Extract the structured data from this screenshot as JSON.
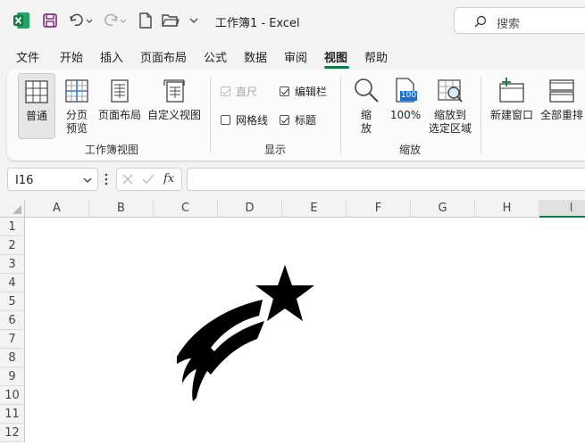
{
  "titlebar": {
    "title": "工作簿1 - Excel",
    "search_label": "搜索",
    "icons": [
      "excel-logo-icon",
      "save-icon",
      "undo-icon",
      "redo-icon",
      "new-file-icon",
      "open-folder-icon",
      "customize-toolbar-icon"
    ]
  },
  "menu": {
    "items": [
      "文件",
      "开始",
      "插入",
      "页面布局",
      "公式",
      "数据",
      "审阅",
      "视图",
      "帮助"
    ],
    "active_index": 7
  },
  "ribbon": {
    "workbook_views": {
      "label": "工作簿视图",
      "normal": "普通",
      "page_break_1": "分页",
      "page_break_2": "预览",
      "page_layout": "页面布局",
      "custom_views": "自定义视图"
    },
    "show": {
      "label": "显示",
      "ruler": "直尺",
      "formula_bar": "编辑栏",
      "gridlines": "网格线",
      "headings": "标题"
    },
    "zoom": {
      "label": "缩放",
      "zoom_1": "缩",
      "zoom_2": "放",
      "hundred": "100%",
      "hundred_icon_text": "100",
      "zoom_sel_1": "缩放到",
      "zoom_sel_2": "选定区域"
    },
    "window": {
      "new_window": "新建窗口",
      "arrange_all": "全部重排"
    }
  },
  "formula_bar": {
    "name_box": "I16",
    "fx": "fx",
    "value": ""
  },
  "sheet": {
    "columns": [
      "A",
      "B",
      "C",
      "D",
      "E",
      "F",
      "G",
      "H",
      "I"
    ],
    "rows": [
      "1",
      "2",
      "3",
      "4",
      "5",
      "6",
      "7",
      "8",
      "9",
      "10",
      "11",
      "12"
    ],
    "selected_column": "I"
  },
  "colors": {
    "accent": "#107c41",
    "shape_fill": "#000000"
  }
}
